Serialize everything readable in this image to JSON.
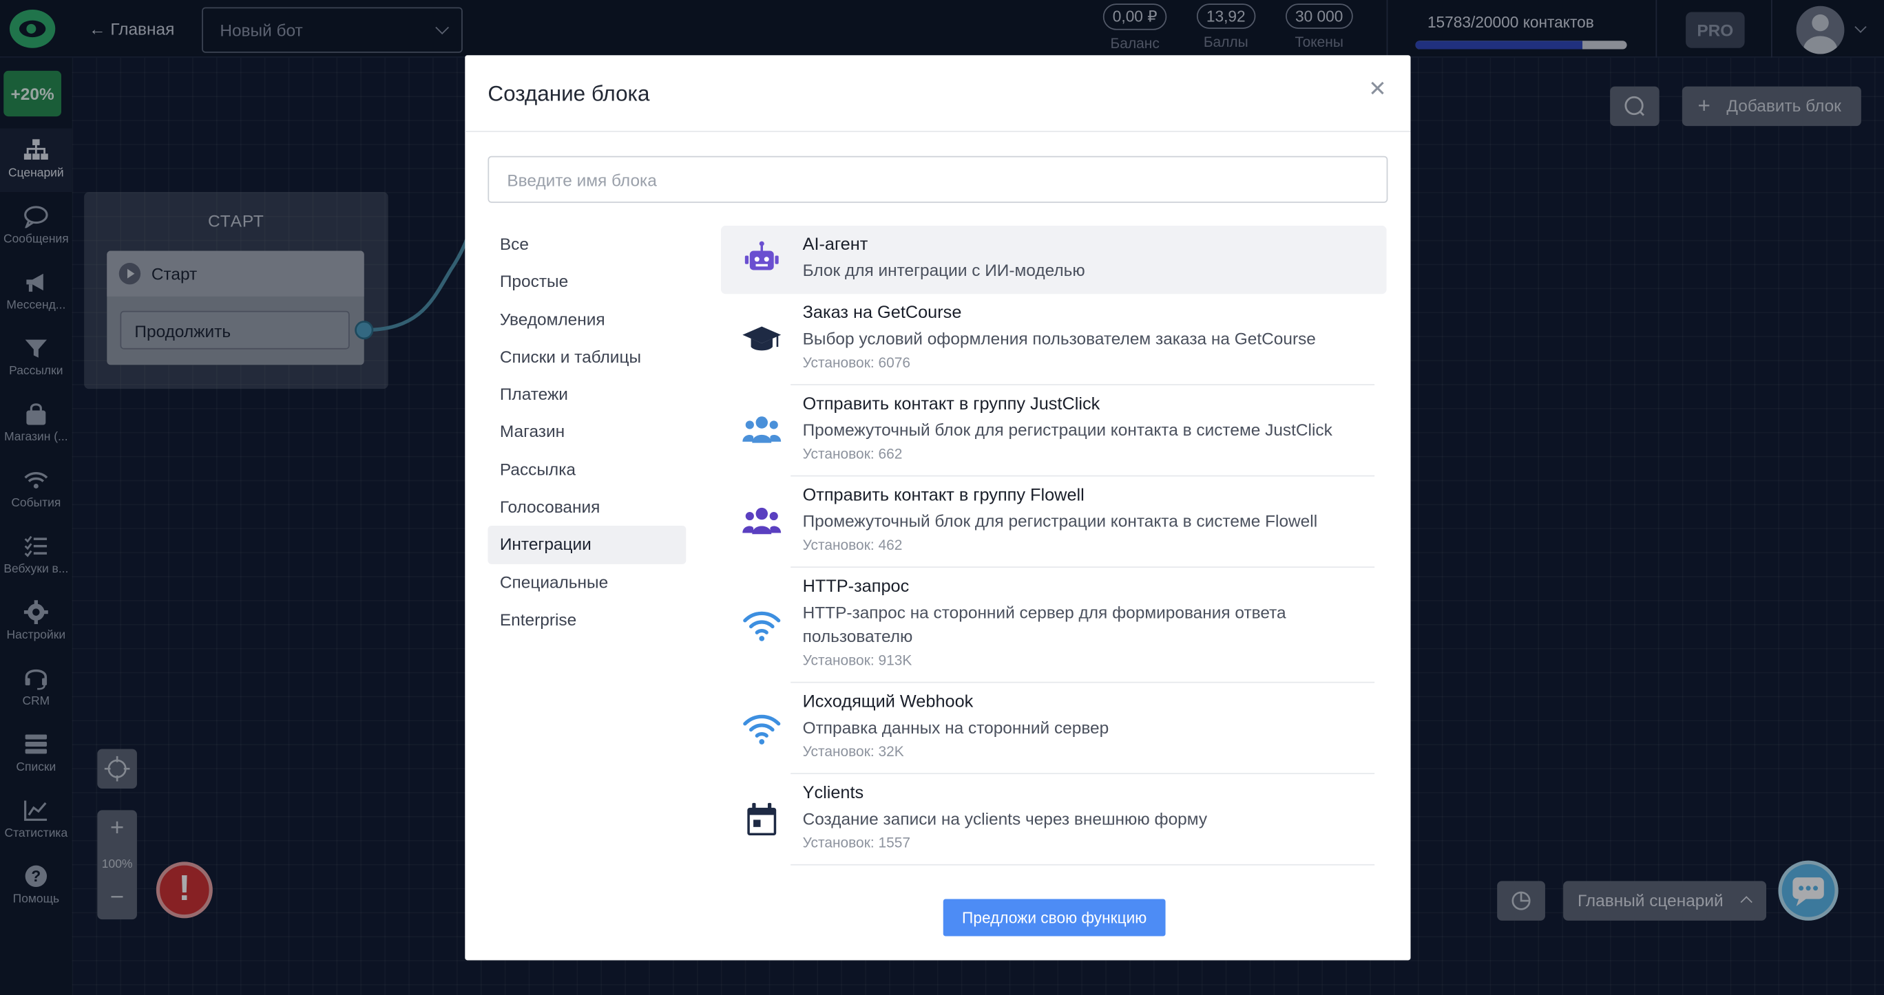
{
  "header": {
    "home_label": "Главная",
    "bot_select_placeholder": "Новый бот",
    "stats": [
      {
        "value": "0,00 ₽",
        "label": "Баланс"
      },
      {
        "value": "13,92",
        "label": "Баллы"
      },
      {
        "value": "30 000",
        "label": "Токены"
      }
    ],
    "contacts_label": "15783/20000 контактов",
    "contacts_progress": 0.789,
    "plan_badge": "PRO"
  },
  "sidebar": {
    "promo": "+20%",
    "items": [
      {
        "label": "Сценарий",
        "icon": "sitemap-icon",
        "active": true
      },
      {
        "label": "Сообщения",
        "icon": "chat-icon"
      },
      {
        "label": "Мессенд...",
        "icon": "megaphone-icon"
      },
      {
        "label": "Рассылки",
        "icon": "funnel-icon"
      },
      {
        "label": "Магазин (...",
        "icon": "bag-icon"
      },
      {
        "label": "События",
        "icon": "wifi-icon"
      },
      {
        "label": "Вебхуки в...",
        "icon": "checklist-icon"
      },
      {
        "label": "Настройки",
        "icon": "gear-icon"
      },
      {
        "label": "CRM",
        "icon": "headset-icon"
      },
      {
        "label": "Списки",
        "icon": "server-icon"
      },
      {
        "label": "Статистика",
        "icon": "chart-icon"
      },
      {
        "label": "Помощь",
        "icon": "help-icon"
      }
    ]
  },
  "canvas": {
    "start_node_title": "СТАРТ",
    "start_card_title": "Старт",
    "start_button": "Продолжить",
    "add_block_label": "Добавить блок",
    "zoom_level": "100%",
    "scenario_selector": "Главный сценарий"
  },
  "modal": {
    "title": "Создание блока",
    "search_placeholder": "Введите имя блока",
    "categories": [
      {
        "label": "Все"
      },
      {
        "label": "Простые"
      },
      {
        "label": "Уведомления"
      },
      {
        "label": "Списки и таблицы"
      },
      {
        "label": "Платежи"
      },
      {
        "label": "Магазин"
      },
      {
        "label": "Рассылка"
      },
      {
        "label": "Голосования"
      },
      {
        "label": "Интеграции",
        "active": true
      },
      {
        "label": "Специальные"
      },
      {
        "label": "Enterprise"
      }
    ],
    "blocks": [
      {
        "name": "AI-агент",
        "description": "Блок для интеграции с ИИ-моделью",
        "installs": "",
        "icon": "robot-icon",
        "icon_color": "#6a4fd0",
        "selected": true
      },
      {
        "name": "Заказ на GetCourse",
        "description": "Выбор условий оформления пользователем заказа на GetCourse",
        "installs": "Установок: 6076",
        "icon": "graduation-cap-icon",
        "icon_color": "#1e2a44"
      },
      {
        "name": "Отправить контакт в группу JustClick",
        "description": "Промежуточный блок для регистрации контакта в системе JustClick",
        "installs": "Установок: 662",
        "icon": "users-icon",
        "icon_color": "#4a90d9"
      },
      {
        "name": "Отправить контакт в группу Flowell",
        "description": "Промежуточный блок для регистрации контакта в системе Flowell",
        "installs": "Установок: 462",
        "icon": "users-icon",
        "icon_color": "#5a3fc0"
      },
      {
        "name": "HTTP-запрос",
        "description": "HTTP-запрос на сторонний сервер для формирования ответа пользователю",
        "installs": "Установок: 913K",
        "icon": "wifi-icon",
        "icon_color": "#3d8fe0"
      },
      {
        "name": "Исходящий Webhook",
        "description": "Отправка данных на сторонний сервер",
        "installs": "Установок: 32K",
        "icon": "wifi-icon",
        "icon_color": "#3d8fe0"
      },
      {
        "name": "Yclients",
        "description": "Создание записи на yclients через внешнюю форму",
        "installs": "Установок: 1557",
        "icon": "calendar-icon",
        "icon_color": "#1e2a44"
      }
    ],
    "suggest_button": "Предложи свою функцию"
  }
}
